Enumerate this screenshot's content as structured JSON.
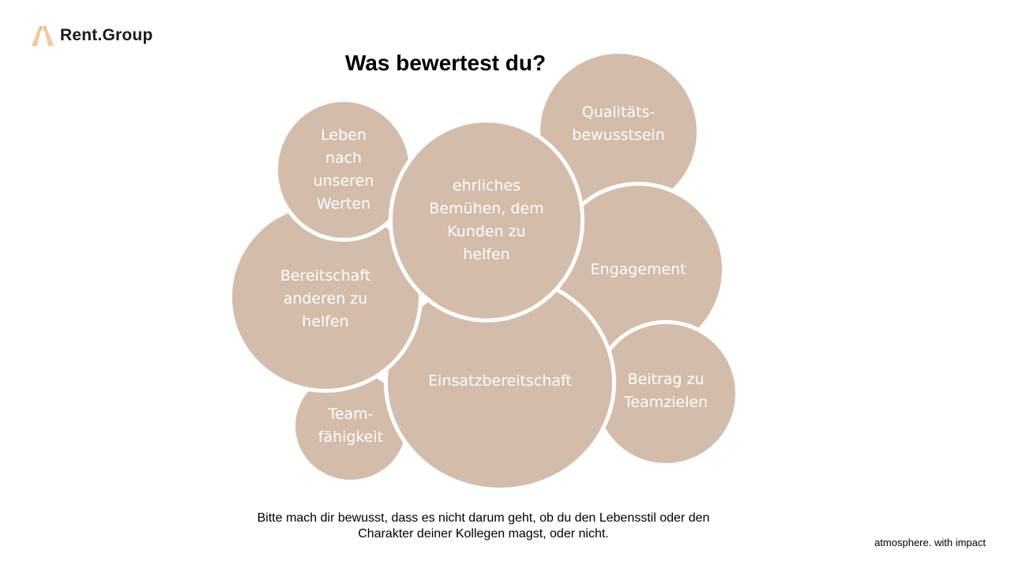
{
  "brand": {
    "name": "Rent.Group",
    "logo_icon": "rent-group-logo-icon",
    "accent": "#f3c99a"
  },
  "slide": {
    "title": "Was bewertest du?",
    "bubble_color": "#d4bcaa",
    "bubbles": [
      {
        "id": "qualitaetsbewusstsein",
        "label": "Qualitäts-\nbewusstsein"
      },
      {
        "id": "leben-nach-werten",
        "label": "Leben\nnach\nunseren\nWerten"
      },
      {
        "id": "engagement",
        "label": "Engagement"
      },
      {
        "id": "bereitschaft",
        "label": "Bereitschaft\nanderen zu\nhelfen"
      },
      {
        "id": "beitrag-teamziele",
        "label": "Beitrag zu\nTeamzielen"
      },
      {
        "id": "teamfaehigkeit",
        "label": "Team-\nfähigkeit"
      },
      {
        "id": "einsatzbereitschaft",
        "label": "Einsatzbereitschaft"
      },
      {
        "id": "ehrliches-bemuehen",
        "label": "ehrliches\nBemühen, dem\nKunden zu\nhelfen"
      }
    ],
    "note": "Bitte mach dir bewusst, dass es nicht darum geht, ob du den Lebensstil oder den\nCharakter deiner Kollegen magst, oder nicht."
  },
  "footer": {
    "tagline": "atmosphere. with impact"
  }
}
